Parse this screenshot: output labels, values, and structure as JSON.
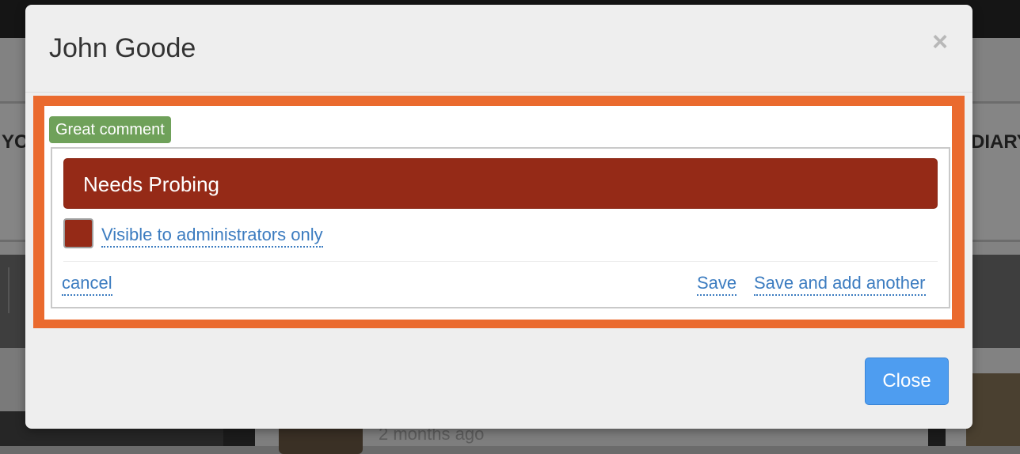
{
  "background": {
    "nav_left_text": "YO",
    "nav_right_text": "DIARY",
    "comment_time": "2 months ago"
  },
  "modal": {
    "title": "John Goode",
    "close_icon": "close-icon",
    "close_glyph": "×",
    "highlight_color": "#ea6a2e",
    "badge": {
      "label": "Great comment",
      "color": "#6fa15a"
    },
    "status": {
      "selected": "Needs Probing",
      "color": "#952a17"
    },
    "visibility_link": "Visible to administrators only",
    "cancel_label": "cancel",
    "save_label": "Save",
    "save_add_label": "Save and add another",
    "close_button_label": "Close",
    "close_button_color": "#4e9df0",
    "link_color": "#3c7cc0"
  }
}
